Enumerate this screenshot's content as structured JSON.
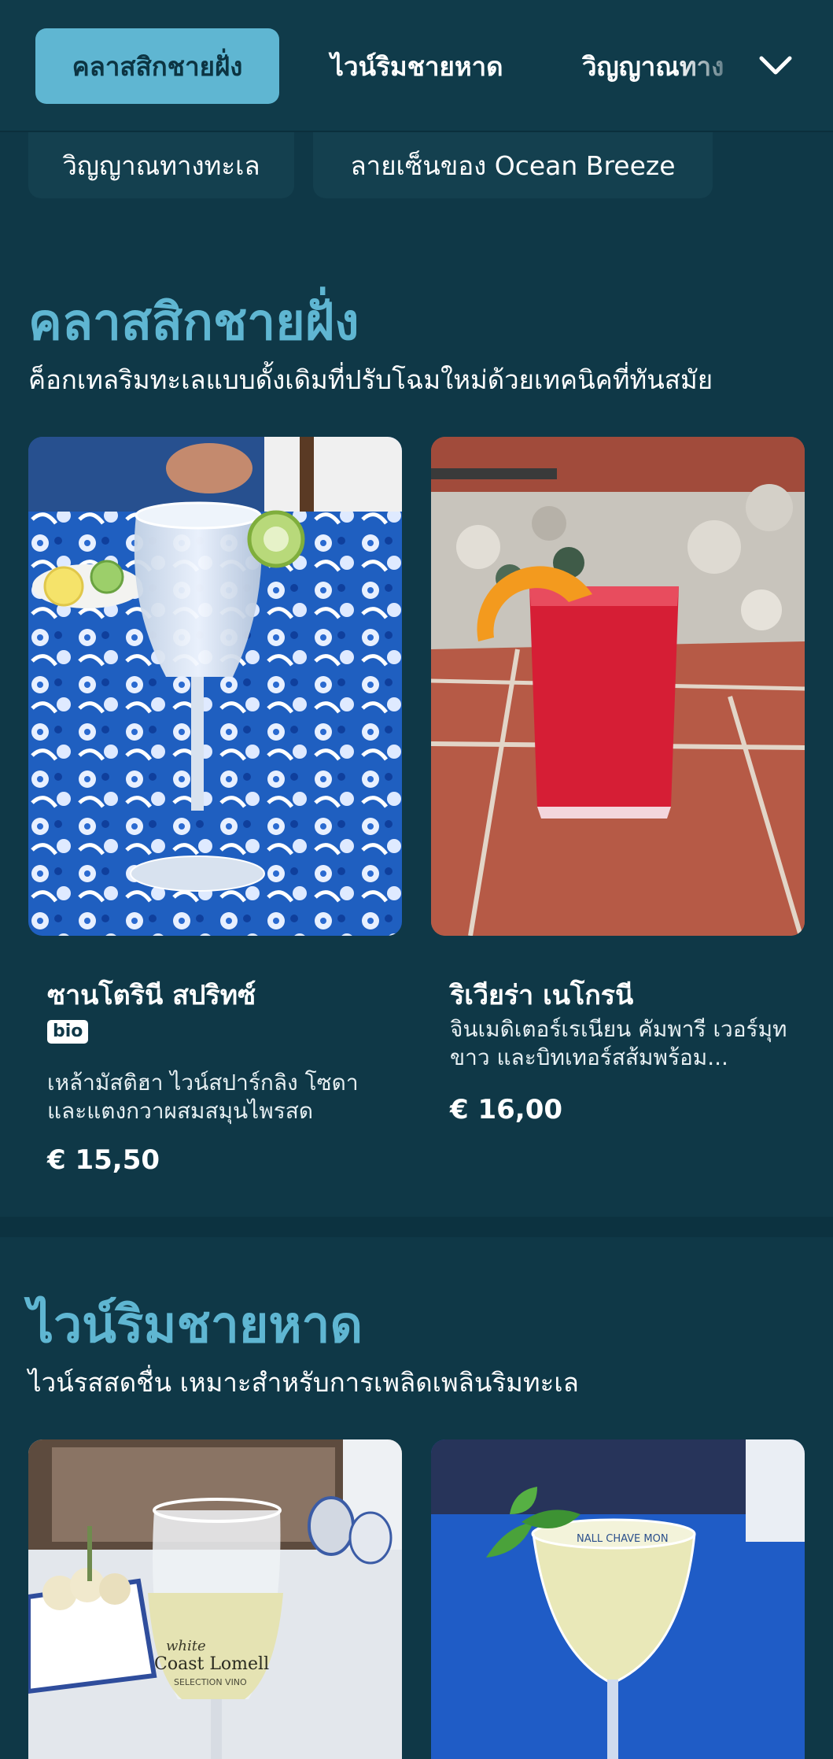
{
  "nav": {
    "tabs": [
      {
        "label": "คลาสสิกชายฝั่ง",
        "active": true
      },
      {
        "label": "ไวน์ริมชายหาด",
        "active": false
      },
      {
        "label": "วิญญาณทาง",
        "active": false
      }
    ],
    "chips": [
      {
        "label": "วิญญาณทางทะเล"
      },
      {
        "label": "ลายเซ็นของ Ocean Breeze"
      }
    ],
    "expand_icon": "chevron-down-icon"
  },
  "sections": [
    {
      "title": "คลาสสิกชายฝั่ง",
      "description": "ค็อกเทลริมทะเลแบบดั้งเดิมที่ปรับโฉมใหม่ด้วยเทคนิคที่ทันสมัย",
      "items": [
        {
          "name": "ซานโตรินี สปริทซ์",
          "badge": "bio",
          "description": "เหล้ามัสติฮา ไวน์สปาร์กลิง โซดา และแตงกวาผสมสมุนไพรสด",
          "price": "€ 15,50"
        },
        {
          "name": "ริเวียร่า เนโกรนี",
          "description": "จินเมดิเตอร์เรเนียน คัมพารี เวอร์มุทขาว และบิทเทอร์สส้มพร้อม...",
          "price": "€ 16,00"
        }
      ]
    },
    {
      "title": "ไวน์ริมชายหาด",
      "description": "ไวน์รสสดชื่น เหมาะสำหรับการเพลิดเพลินริมทะเล",
      "image_texts": {
        "wine_label_1": "white",
        "wine_label_2": "Coast Lomell",
        "wine_label_3": "SELECTION VINO",
        "glass_rim": "NALL CHAVE MON"
      }
    }
  ],
  "colors": {
    "background": "#0f3847",
    "accent": "#5fb6d2",
    "chip": "#14404f"
  }
}
